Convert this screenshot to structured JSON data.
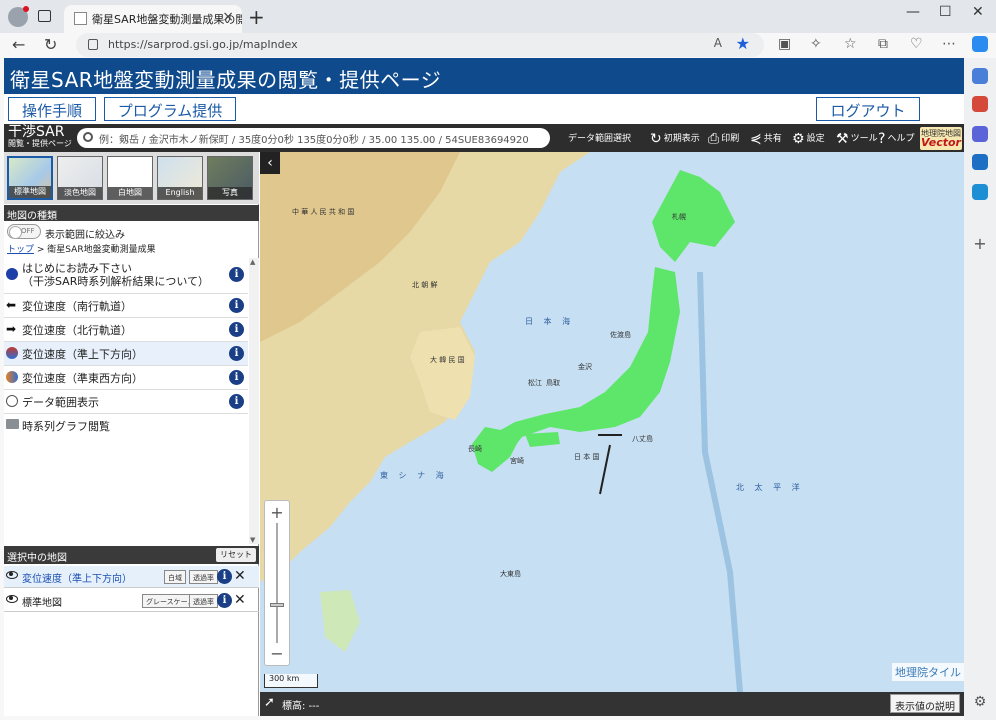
{
  "browser": {
    "tab_title": "衛星SAR地盤変動測量成果の閲覧",
    "url": "https://sarprod.gsi.go.jp/mapIndex",
    "read_aloud": "A",
    "new_tab": "+"
  },
  "banner": {
    "title": "衛星SAR地盤変動測量成果の閲覧・提供ページ"
  },
  "menu": {
    "manual": "操作手順",
    "program": "プログラム提供",
    "logout": "ログアウト"
  },
  "header": {
    "logo_main": "干渉SAR",
    "logo_sub": "閲覧・提供ページ",
    "search_placeholder": "例：剱岳 / 金沢市木ノ新保町 / 35度0分0秒 135度0分0秒 / 35.00 135.00 / 54SUE83694920",
    "data_range": "データ範囲選択",
    "initial": "初期表示",
    "print": "印刷",
    "share": "共有",
    "settings": "設定",
    "tools": "ツール",
    "help": "ヘルプ",
    "gsi_logo_top": "地理院地図",
    "gsi_logo_bottom": "Vector"
  },
  "basemaps": [
    {
      "label": "標準地図"
    },
    {
      "label": "淡色地図"
    },
    {
      "label": "白地図"
    },
    {
      "label": "English"
    },
    {
      "label": "写真"
    }
  ],
  "map_types": {
    "section": "地図の種類",
    "toggle_state": "OFF",
    "toggle_label": "表示範囲に絞込み",
    "crumb_top": "トップ",
    "crumb_rest": " > 衛星SAR地盤変動測量成果"
  },
  "layers": [
    {
      "line1": "はじめにお読み下さい",
      "line2": "（干渉SAR時系列解析結果について）",
      "icon_color": "#1b3fa6"
    },
    {
      "line1": "変位速度（南行軌道）",
      "icon_color": "#111"
    },
    {
      "line1": "変位速度（北行軌道）",
      "icon_color": "#111"
    },
    {
      "line1": "変位速度（準上下方向）",
      "icon_color": "#c0392b"
    },
    {
      "line1": "変位速度（準東西方向）",
      "icon_color": "#e67e22"
    },
    {
      "line1": "データ範囲表示",
      "icon_color": "#555"
    },
    {
      "line1": "時系列グラフ閲覧",
      "icon_color": "#8a8f96"
    }
  ],
  "info_glyph": "i",
  "selected": {
    "section": "選択中の地図",
    "reset": "リセット",
    "rows": [
      {
        "name": "変位速度（準上下方向）",
        "btn1": "白域",
        "btn2": "透過率"
      },
      {
        "name": "標準地図",
        "btn1": "グレースケール",
        "btn2": "透過率"
      }
    ],
    "close_glyph": "✕"
  },
  "map": {
    "collapse_glyph": "‹",
    "zoom_in": "+",
    "zoom_out": "−",
    "scale": "300 km",
    "tile_label": "地理院タイル",
    "labels": {
      "china": "中 華 人 民 共 和 国",
      "nkorea": "北 朝 鮮",
      "korea": "大 韓 民 国",
      "sea_japan": "日 本 海",
      "ecs": "東 シ ナ 海",
      "pacific": "北 太 平 洋",
      "nihon": "日 本 国",
      "sapporo": "札幌",
      "kanazawa": "金沢",
      "tottori": "鳥取",
      "matsue": "松江",
      "nagasaki": "長崎",
      "miyazaki": "宮崎",
      "hachijo": "八丈島",
      "sado": "佐渡島",
      "okinawa": "大東島"
    }
  },
  "bottom": {
    "elevation": "標高: ---",
    "legend_btn": "表示値の説明"
  },
  "colors": {
    "banner": "#0e4a8c",
    "sea": "#c6dff2",
    "land_jp": "#5ee66a",
    "land_asia": "#e6d9a6"
  }
}
